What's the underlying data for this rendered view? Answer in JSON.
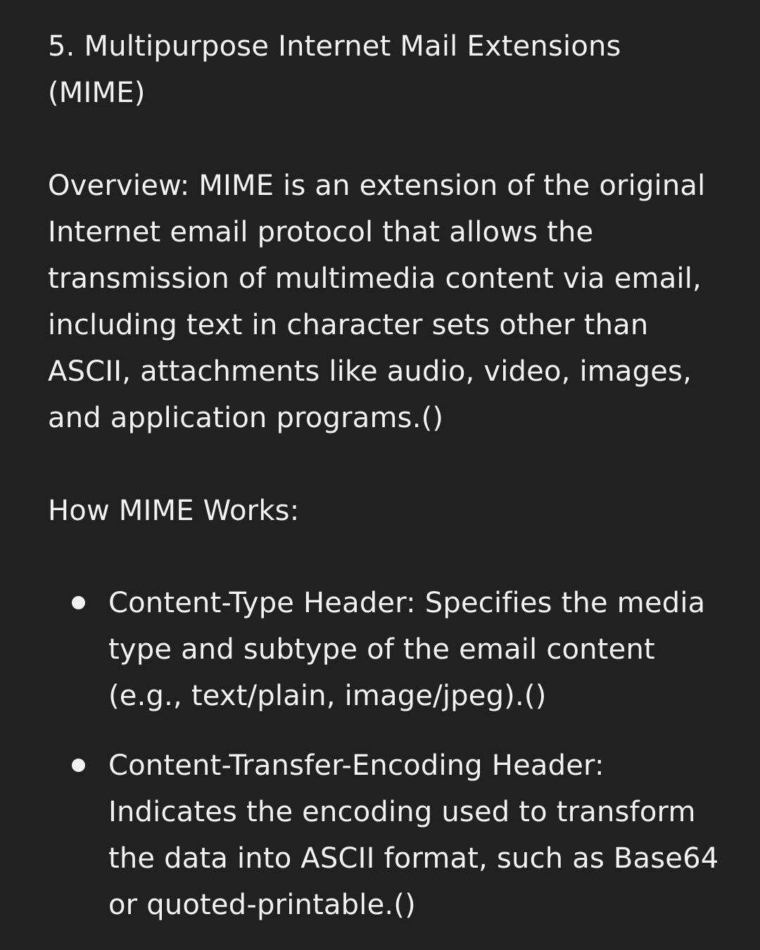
{
  "section": {
    "title": "5. Multipurpose Internet Mail Extensions\n(MIME)",
    "overview": "Overview: MIME is an extension of the original Internet email protocol that allows the transmission of multimedia content via email, including text in character sets other than ASCII, attachments like audio, video, images, and application programs.()",
    "how_heading": "How MIME Works:",
    "bullets": [
      {
        "text": "Content-Type Header: Specifies the media type and subtype of the email content (e.g., text/plain, image/jpeg).()"
      },
      {
        "text": "Content-Transfer-Encoding Header: Indicates the encoding used to transform the data into ASCII format, such as Base64 or quoted-printable.()"
      }
    ]
  }
}
